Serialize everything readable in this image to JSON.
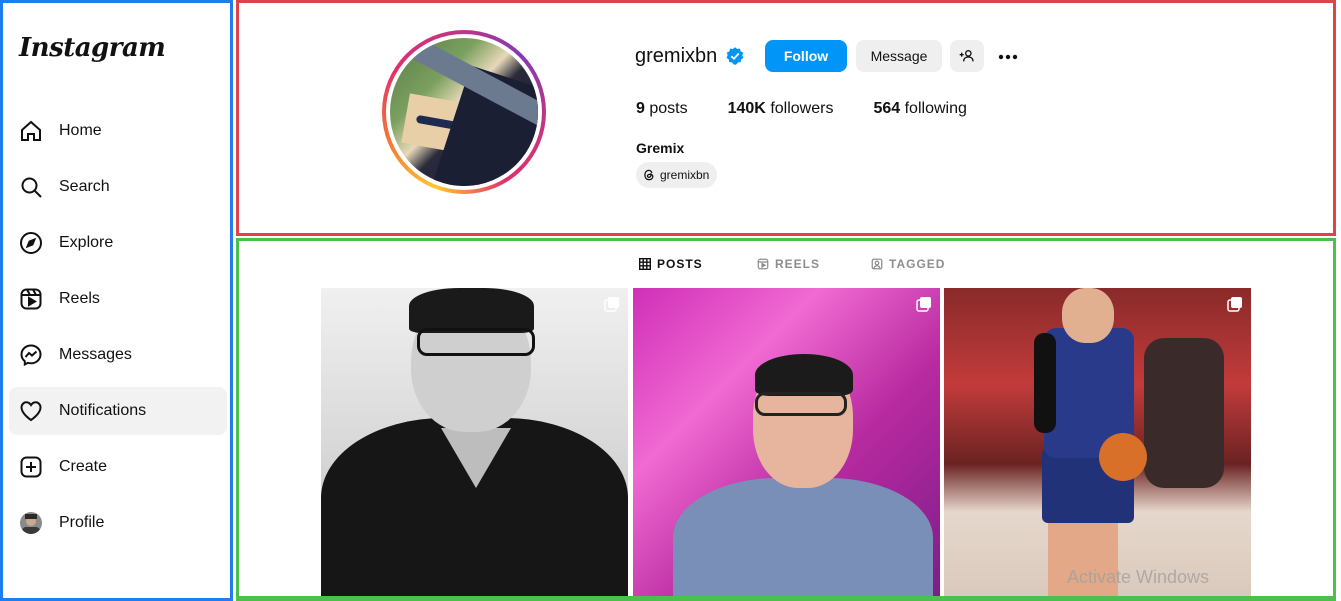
{
  "sidebar": {
    "logo": "Instagram",
    "items": [
      {
        "label": "Home",
        "icon": "home-icon"
      },
      {
        "label": "Search",
        "icon": "search-icon"
      },
      {
        "label": "Explore",
        "icon": "compass-icon"
      },
      {
        "label": "Reels",
        "icon": "reels-icon"
      },
      {
        "label": "Messages",
        "icon": "messenger-icon"
      },
      {
        "label": "Notifications",
        "icon": "heart-icon"
      },
      {
        "label": "Create",
        "icon": "plus-square-icon"
      },
      {
        "label": "Profile",
        "icon": "avatar"
      }
    ],
    "active_item": "Notifications"
  },
  "profile": {
    "username": "gremixbn",
    "verified": true,
    "follow_label": "Follow",
    "message_label": "Message",
    "posts_count": "9",
    "posts_label": "posts",
    "followers_count": "140K",
    "followers_label": "followers",
    "following_count": "564",
    "following_label": "following",
    "full_name": "Gremix",
    "threads_handle": "gremixbn"
  },
  "tabs": [
    {
      "label": "POSTS",
      "icon": "grid-icon",
      "active": true
    },
    {
      "label": "REELS",
      "icon": "reels-icon",
      "active": false
    },
    {
      "label": "TAGGED",
      "icon": "tagged-icon",
      "active": false
    }
  ],
  "posts": [
    {
      "description": "black and white portrait",
      "multi": true
    },
    {
      "description": "portrait with pink lights",
      "multi": true
    },
    {
      "description": "basketball all-star photo",
      "multi": true
    }
  ],
  "overlay": {
    "watermark": "Activate Windows"
  },
  "colors": {
    "accent": "#0095f6",
    "verified": "#0095f6",
    "active_nav_bg": "#f2f2f2"
  }
}
